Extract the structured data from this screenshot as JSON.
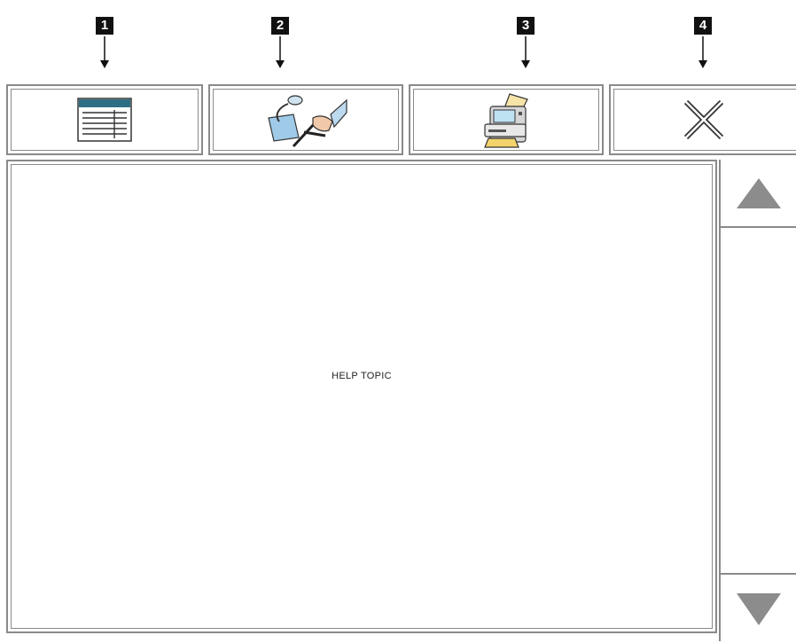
{
  "callouts": [
    {
      "number": "1"
    },
    {
      "number": "2"
    },
    {
      "number": "3"
    },
    {
      "number": "4"
    }
  ],
  "toolbar": {
    "buttons": [
      {
        "icon": "table-of-contents-icon"
      },
      {
        "icon": "magnifier-hand-search-icon"
      },
      {
        "icon": "printer-icon"
      },
      {
        "icon": "close-icon"
      }
    ]
  },
  "content": {
    "text": "HELP TOPIC"
  },
  "scrollbar": {
    "up_icon": "triangle-up-icon",
    "down_icon": "triangle-down-icon",
    "arrow_color": "#8c8c8c"
  }
}
